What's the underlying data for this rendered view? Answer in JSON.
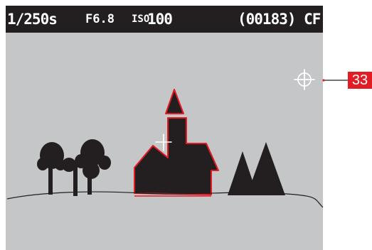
{
  "viewfinder": {
    "status_bar": {
      "shutter_speed": "1/250s",
      "aperture": "F6.8",
      "iso_label": "ISO",
      "iso_value": "100",
      "frame_counter": "(00183) CF"
    },
    "scene": {
      "subject": "church",
      "background_color": "#c4c6c7",
      "silhouette_color": "#231f20",
      "highlight_color": "#e31b23"
    }
  },
  "annotation": {
    "callout_number": "33"
  }
}
